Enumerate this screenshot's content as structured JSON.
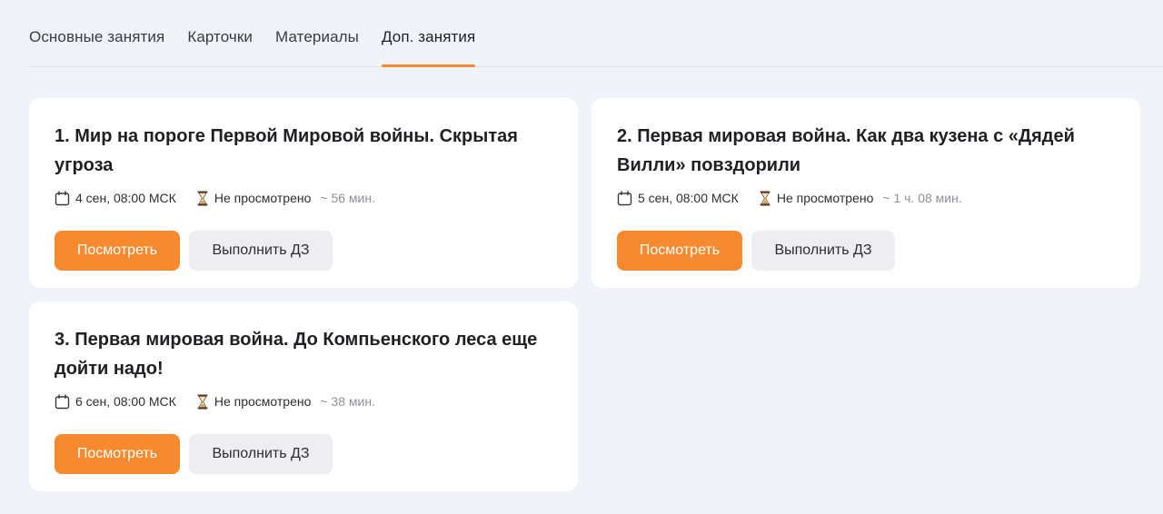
{
  "tabs": [
    {
      "label": "Основные занятия",
      "active": false
    },
    {
      "label": "Карточки",
      "active": false
    },
    {
      "label": "Материалы",
      "active": false
    },
    {
      "label": "Доп. занятия",
      "active": true
    }
  ],
  "colors": {
    "accent": "#f58a2e",
    "background": "#f0f3fa",
    "card": "#ffffff",
    "secondary_button": "#eeeef2"
  },
  "icons": {
    "date": "calendar-icon",
    "status": "hourglass-icon"
  },
  "lessons": [
    {
      "title": "1. Мир на пороге Первой Мировой войны. Скрытая угроза",
      "date": "4 сен, 08:00 МСК",
      "status": "Не просмотрено",
      "duration": "~ 56 мин.",
      "watch_label": "Посмотреть",
      "homework_label": "Выполнить ДЗ"
    },
    {
      "title": "2. Первая мировая война. Как два кузена с «Дядей Вилли» повздорили",
      "date": "5 сен, 08:00 МСК",
      "status": "Не просмотрено",
      "duration": "~ 1 ч. 08 мин.",
      "watch_label": "Посмотреть",
      "homework_label": "Выполнить ДЗ"
    },
    {
      "title": "3. Первая мировая война. До Компьенского леса еще дойти надо!",
      "date": "6 сен, 08:00 МСК",
      "status": "Не просмотрено",
      "duration": "~ 38 мин.",
      "watch_label": "Посмотреть",
      "homework_label": "Выполнить ДЗ"
    }
  ]
}
